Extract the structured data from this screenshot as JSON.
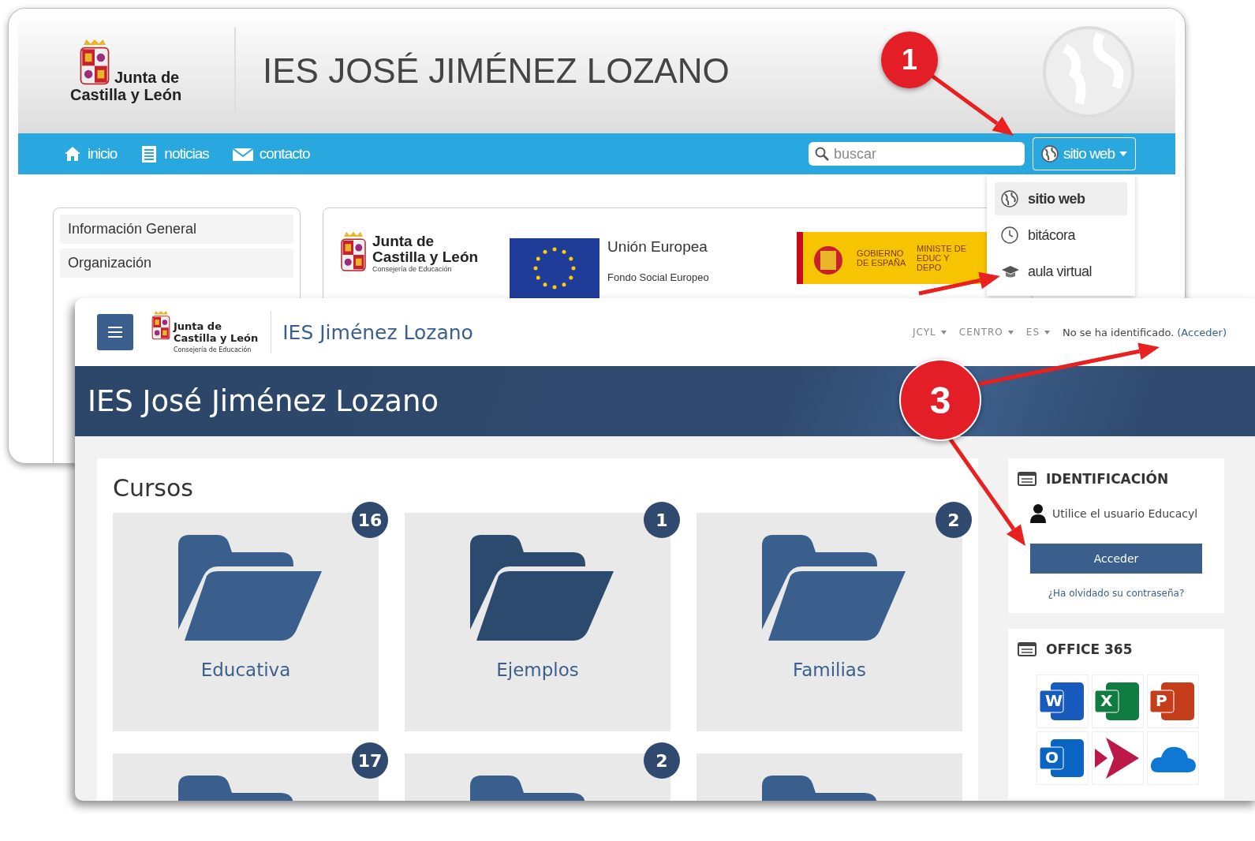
{
  "back_window": {
    "logo": {
      "line1": "Junta de",
      "line2": "Castilla y León"
    },
    "title": "IES JOSÉ JIMÉNEZ LOZANO",
    "nav": [
      {
        "label": "inicio",
        "kind": "home"
      },
      {
        "label": "noticias",
        "kind": "news"
      },
      {
        "label": "contacto",
        "kind": "mail"
      }
    ],
    "search": {
      "placeholder": "buscar"
    },
    "site_button": {
      "label": "sitio web"
    },
    "dropdown": [
      {
        "label": "sitio web",
        "kind": "globe",
        "selected": true
      },
      {
        "label": "bitácora",
        "kind": "clock",
        "selected": false
      },
      {
        "label": "aula virtual",
        "kind": "cap",
        "selected": false
      }
    ],
    "menu": [
      "Información General",
      "Organización"
    ],
    "banner": {
      "junta": {
        "line1": "Junta de",
        "line2": "Castilla y León",
        "line3": "Consejería de Educación"
      },
      "eu_title": "Unión Europea",
      "eu_sub": "Fondo Social Europeo",
      "gov": "GOBIERNO DE ESPAÑA",
      "ministry": "MINISTE DE EDUC Y DEPO"
    }
  },
  "front_window": {
    "logo": {
      "line1": "Junta de",
      "line2": "Castilla y León",
      "line3": "Consejería de Educación"
    },
    "site_name": "IES Jiménez Lozano",
    "top_links": [
      {
        "label": "JCYL"
      },
      {
        "label": "CENTRO"
      },
      {
        "label": "ES"
      }
    ],
    "login_status": "No se ha identificado.",
    "login_link": "(Acceder)",
    "banner_title": "IES José Jiménez Lozano",
    "courses_title": "Cursos",
    "courses": [
      {
        "name": "Educativa",
        "count": "16",
        "color": "#3a5f8c"
      },
      {
        "name": "Ejemplos",
        "count": "1",
        "color": "#2b4a6d"
      },
      {
        "name": "Familias",
        "count": "2",
        "color": "#3a5f8c"
      },
      {
        "count": "17",
        "color": "#3a5f8c"
      },
      {
        "count": "2",
        "color": "#3a5f8c"
      },
      {
        "color": "#3a5f8c"
      }
    ],
    "login_block": {
      "title": "IDENTIFICACIÓN",
      "hint": "Utilice el usuario Educacyl",
      "button": "Acceder",
      "forgot": "¿Ha olvidado su contraseña?"
    },
    "office_block": {
      "title": "OFFICE 365",
      "apps": [
        {
          "kind": "letter",
          "letter": "W",
          "color": "#185abd"
        },
        {
          "kind": "letter",
          "letter": "X",
          "color": "#107c41"
        },
        {
          "kind": "letter",
          "letter": "P",
          "color": "#c43e1c"
        },
        {
          "kind": "letter",
          "letter": "O",
          "color": "#0a64c2"
        },
        {
          "kind": "stream",
          "color": "#bc1948"
        },
        {
          "kind": "cloud",
          "color": "#0f78d4"
        }
      ]
    }
  },
  "callouts": [
    {
      "label": "1"
    },
    {
      "label": "3"
    }
  ]
}
